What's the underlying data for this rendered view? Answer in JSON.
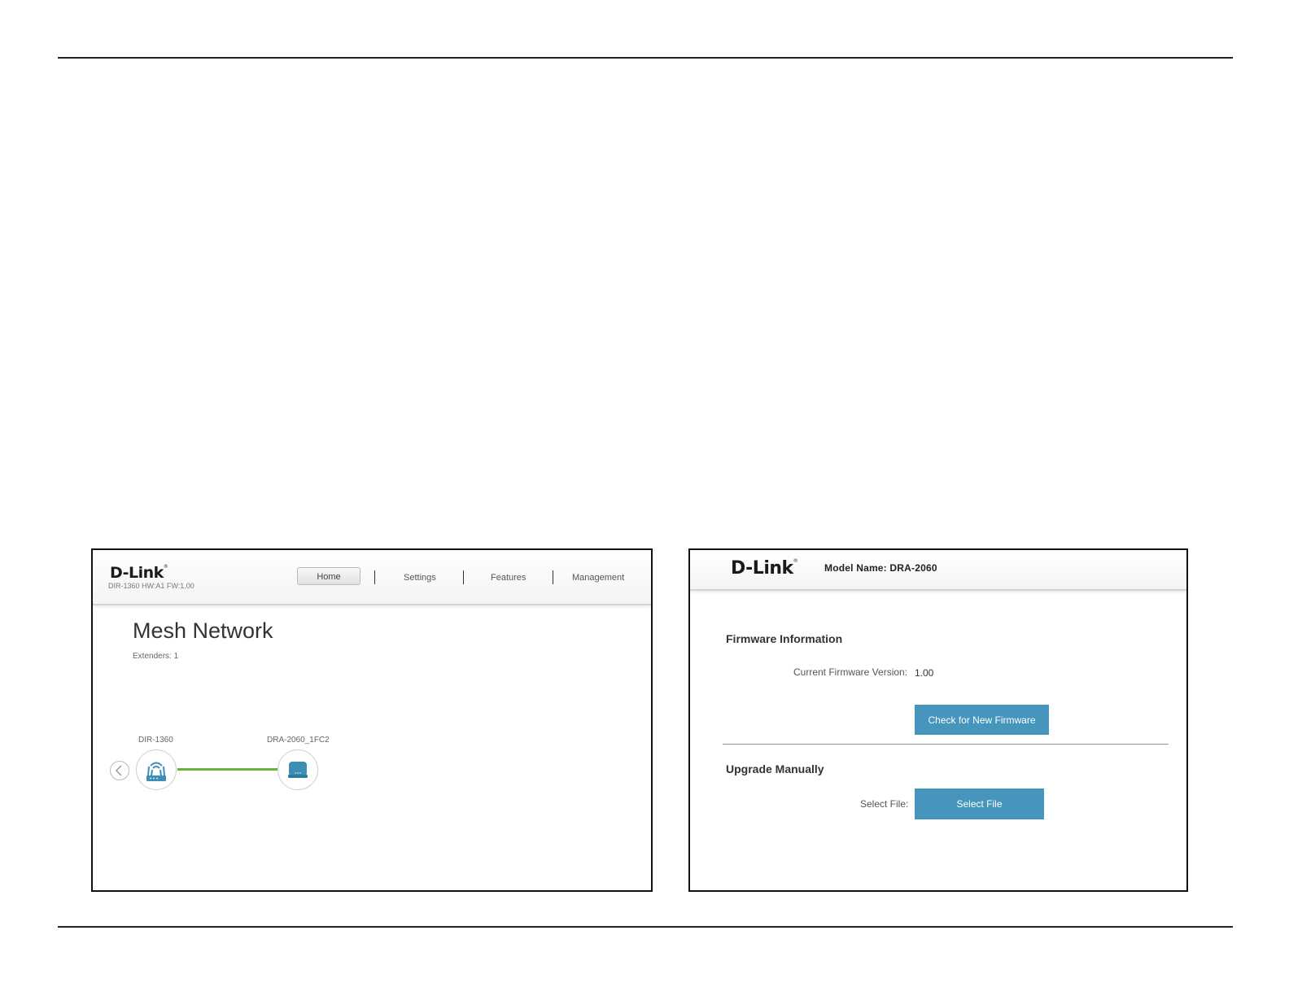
{
  "left_screen": {
    "logo": "D-Link",
    "logo_mark": "®",
    "hw_info": "DIR-1360 HW:A1 FW:1.00",
    "nav": {
      "home": "Home",
      "settings": "Settings",
      "features": "Features",
      "management": "Management"
    },
    "page_title": "Mesh Network",
    "extenders": "Extenders: 1",
    "nodes": {
      "router_label": "DIR-1360",
      "extender_label": "DRA-2060_1FC2"
    },
    "colors": {
      "link": "#6bb33f",
      "icon": "#3b8fb5"
    },
    "icons": {
      "back": "chevron-left-icon",
      "router": "router-icon",
      "extender": "extender-icon"
    }
  },
  "right_screen": {
    "logo": "D-Link",
    "logo_mark": "®",
    "model_name": "Model Name: DRA-2060",
    "firmware_section": "Firmware Information",
    "current_version_label": "Current Firmware Version:",
    "current_version_value": "1.00",
    "check_button": "Check for New Firmware",
    "upgrade_section": "Upgrade Manually",
    "select_file_label": "Select File:",
    "select_file_button": "Select File",
    "colors": {
      "button": "#4595bd"
    }
  }
}
